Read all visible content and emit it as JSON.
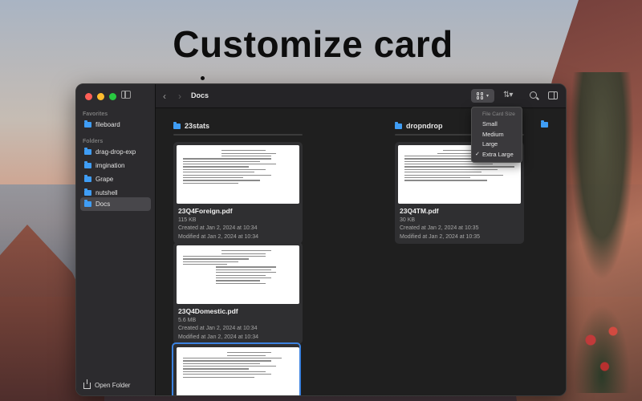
{
  "headline": "Customize card",
  "window": {
    "sidebar": {
      "sections": [
        {
          "label": "Favorites",
          "items": [
            {
              "label": "fileboard"
            }
          ]
        },
        {
          "label": "Folders",
          "items": [
            {
              "label": "drag-drop-exp"
            },
            {
              "label": "imgination"
            },
            {
              "label": "Grape"
            },
            {
              "label": "nutshell"
            },
            {
              "label": "Docs"
            }
          ]
        }
      ],
      "selected": "Docs",
      "open_folder_label": "Open Folder"
    },
    "toolbar": {
      "back_glyph": "‹",
      "forward_glyph": "›",
      "title": "Docs"
    },
    "columns": [
      {
        "name": "23stats",
        "cards": [
          {
            "name": "23Q4Foreign.pdf",
            "size": "115 KB",
            "created": "Created at Jan 2, 2024 at 10:34",
            "modified": "Modified at Jan 2, 2024 at 10:34"
          },
          {
            "name": "23Q4Domestic.pdf",
            "size": "5.6 MB",
            "created": "Created at Jan 2, 2024 at 10:34",
            "modified": "Modified at Jan 2, 2024 at 10:34"
          }
        ]
      },
      {
        "name": "dropndrop",
        "cards": [
          {
            "name": "23Q4TM.pdf",
            "size": "30 KB",
            "created": "Created at Jan 2, 2024 at 10:35",
            "modified": "Modified at Jan 2, 2024 at 10:35"
          }
        ]
      }
    ],
    "card_size_menu": {
      "heading": "File Card Size",
      "options": [
        "Small",
        "Medium",
        "Large",
        "Extra Large"
      ],
      "selected": "Extra Large",
      "check_glyph": "✓"
    }
  },
  "colors": {
    "accent": "#3b82e0",
    "folder": "#3f9df5",
    "window_bg": "#1e1e1e",
    "sidebar_bg": "#2c2b2e"
  }
}
